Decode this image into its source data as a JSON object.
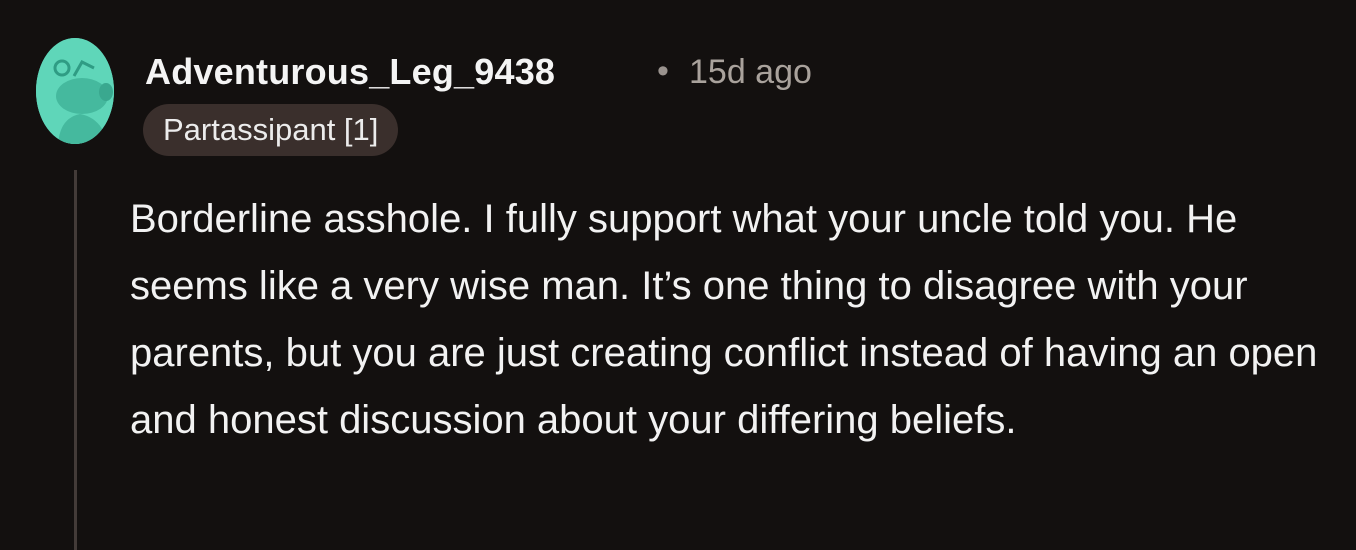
{
  "comment": {
    "author": "Adventurous_Leg_9438",
    "separator": "•",
    "timestamp": "15d ago",
    "flair": "Partassipant [1]",
    "body": "Borderline asshole. I fully support what your uncle told you. He seems like a very wise man. It’s one thing to disagree with your parents, but you are just creating conflict instead of having an open and honest discussion about your differing beliefs.",
    "avatar_icon": "snoo-avatar-icon"
  },
  "colors": {
    "background": "#13100f",
    "avatar": "#5fd6b9",
    "flair_bg": "#3a2f2c",
    "meta_text": "#a9a29c",
    "thread_line": "#433b38"
  }
}
